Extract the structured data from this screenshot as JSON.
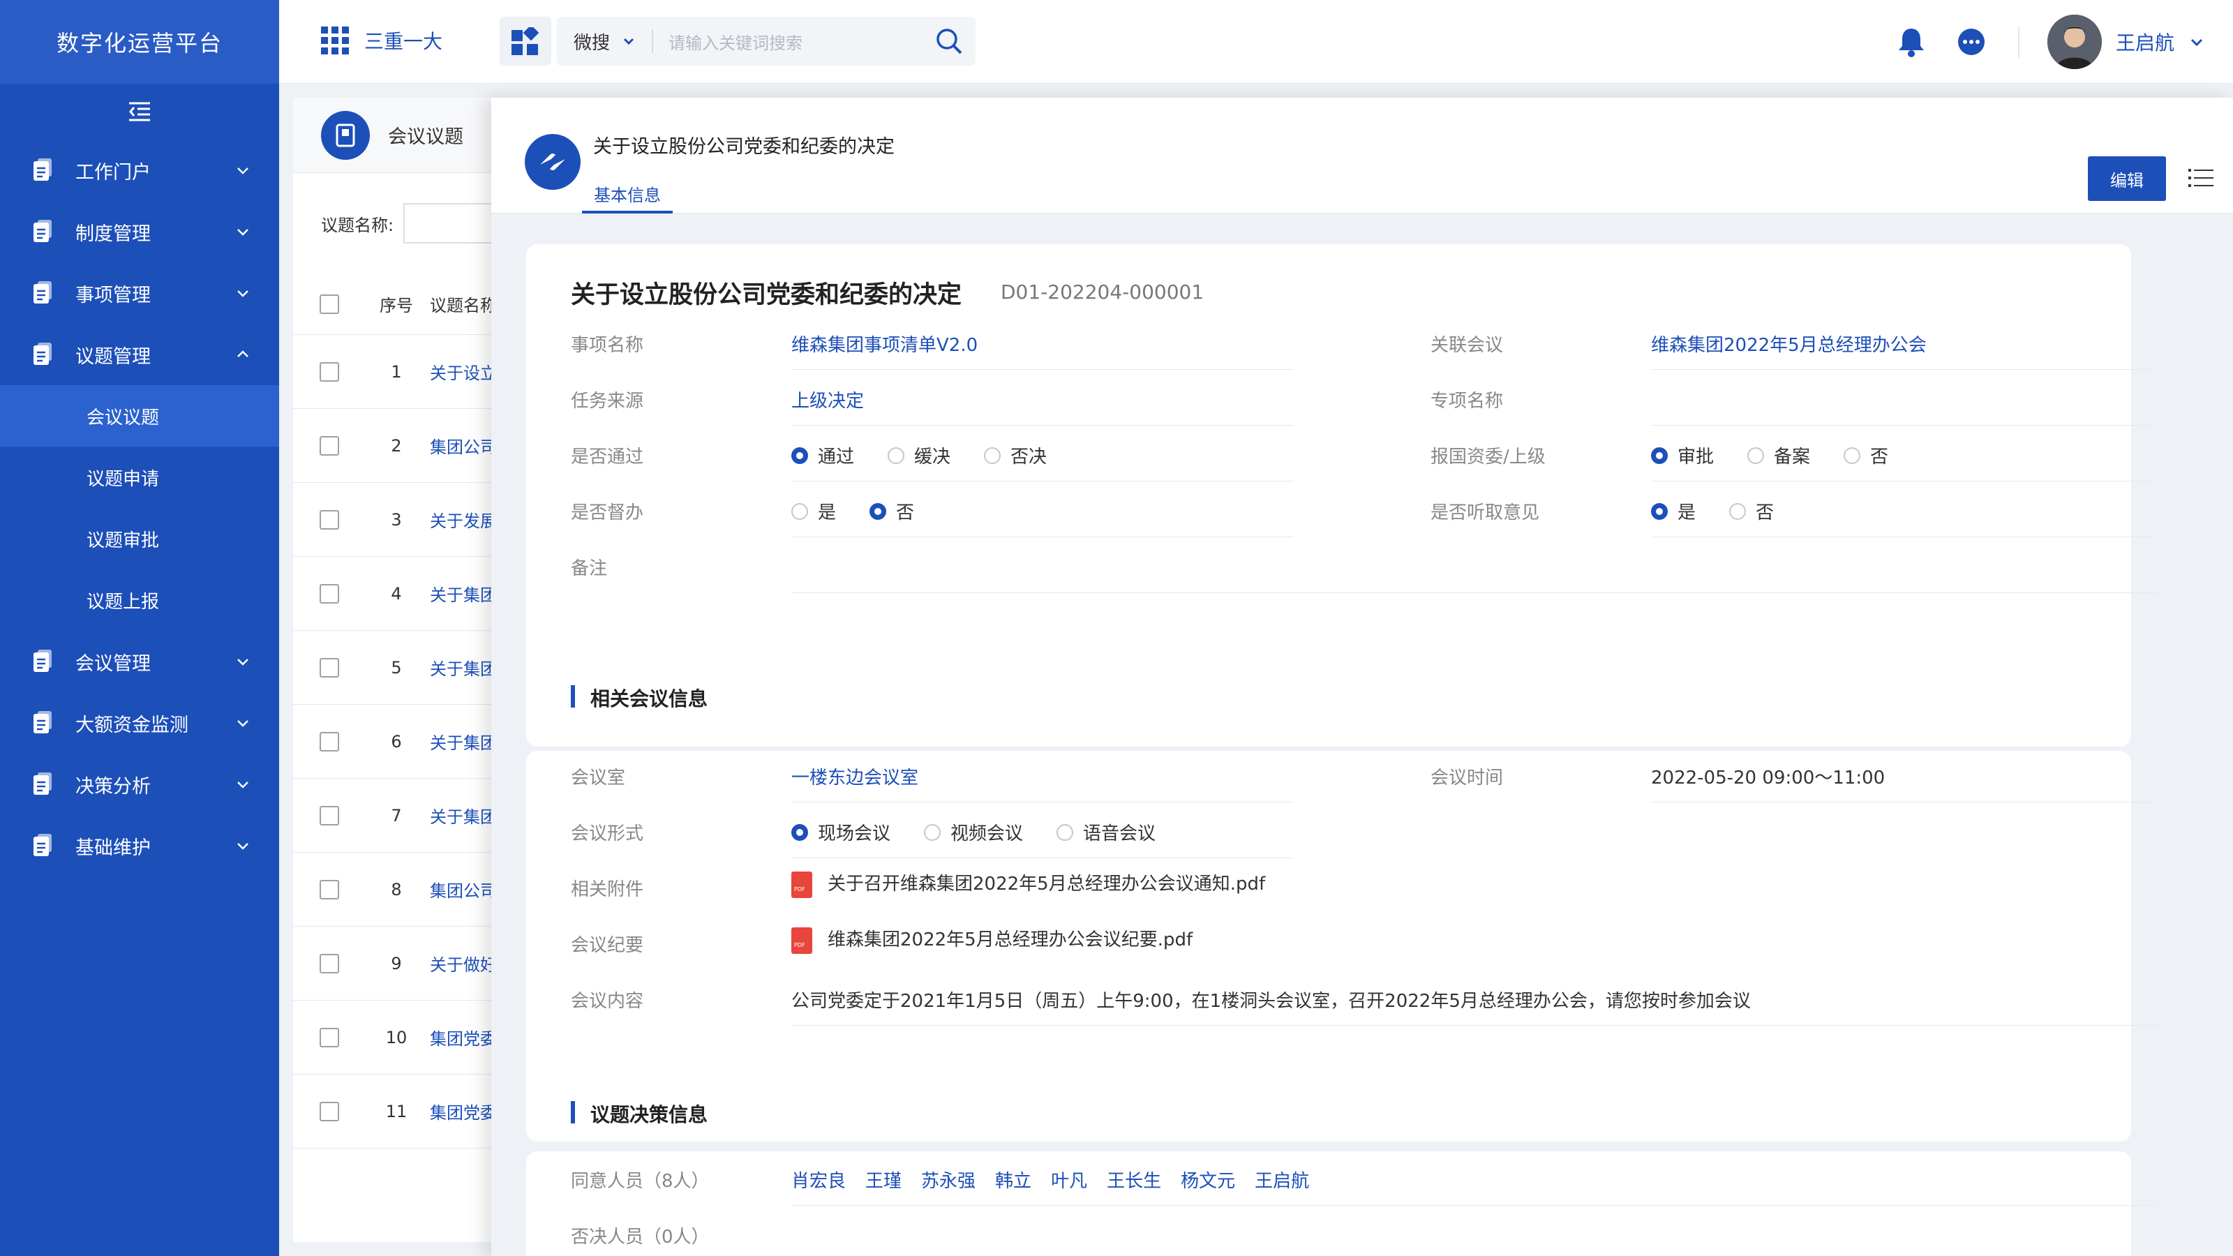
{
  "sidebar": {
    "brand": "数字化运营平台",
    "items": [
      {
        "label": "工作门户"
      },
      {
        "label": "制度管理"
      },
      {
        "label": "事项管理"
      },
      {
        "label": "议题管理"
      },
      {
        "label": "会议管理"
      },
      {
        "label": "大额资金监测"
      },
      {
        "label": "决策分析"
      },
      {
        "label": "基础维护"
      }
    ],
    "submenu": [
      {
        "label": "会议议题"
      },
      {
        "label": "议题申请"
      },
      {
        "label": "议题审批"
      },
      {
        "label": "议题上报"
      }
    ]
  },
  "topbar": {
    "app_label": "三重一大",
    "search_scope": "微搜",
    "search_placeholder": "请输入关键词搜索",
    "user_name": "王启航"
  },
  "listpage": {
    "title": "会议议题",
    "filter_label": "议题名称:",
    "col_no": "序号",
    "col_name": "议题名称",
    "rows": [
      {
        "no": "1",
        "name": "关于设立"
      },
      {
        "no": "2",
        "name": "集团公司"
      },
      {
        "no": "3",
        "name": "关于发展"
      },
      {
        "no": "4",
        "name": "关于集团"
      },
      {
        "no": "5",
        "name": "关于集团"
      },
      {
        "no": "6",
        "name": "关于集团"
      },
      {
        "no": "7",
        "name": "关于集团"
      },
      {
        "no": "8",
        "name": "集团公司"
      },
      {
        "no": "9",
        "name": "关于做好"
      },
      {
        "no": "10",
        "name": "集团党委"
      },
      {
        "no": "11",
        "name": "集团党委"
      }
    ]
  },
  "detail": {
    "header_title": "关于设立股份公司党委和纪委的决定",
    "tab": "基本信息",
    "edit_label": "编辑",
    "title": "关于设立股份公司党委和纪委的决定",
    "code": "D01-202204-000001",
    "basic": {
      "item_name_label": "事项名称",
      "item_name": "维森集团事项清单V2.0",
      "meeting_label": "关联会议",
      "meeting": "维森集团2022年5月总经理办公会",
      "source_label": "任务来源",
      "source": "上级决定",
      "special_label": "专项名称",
      "pass_label": "是否通过",
      "pass_options": [
        "通过",
        "缓决",
        "否决"
      ],
      "pass_selected": "通过",
      "report_label": "报国资委/上级",
      "report_options": [
        "审批",
        "备案",
        "否"
      ],
      "report_selected": "审批",
      "supervise_label": "是否督办",
      "supervise_options": [
        "是",
        "否"
      ],
      "supervise_selected": "否",
      "opinion_label": "是否听取意见",
      "opinion_options": [
        "是",
        "否"
      ],
      "opinion_selected": "是",
      "remark_label": "备注"
    },
    "meeting_info": {
      "section_title": "相关会议信息",
      "room_label": "会议室",
      "room": "一楼东边会议室",
      "time_label": "会议时间",
      "time": "2022-05-20  09:00～11:00",
      "form_label": "会议形式",
      "form_options": [
        "现场会议",
        "视频会议",
        "语音会议"
      ],
      "form_selected": "现场会议",
      "attach_label": "相关附件",
      "attach": "关于召开维森集团2022年5月总经理办公会议通知.pdf",
      "minutes_label": "会议纪要",
      "minutes": "维森集团2022年5月总经理办公会议纪要.pdf",
      "content_label": "会议内容",
      "content": "公司党委定于2021年1月5日（周五）上午9:00，在1楼洞头会议室，召开2022年5月总经理办公会，请您按时参加会议"
    },
    "decision": {
      "section_title": "议题决策信息",
      "agree_label": "同意人员（8人）",
      "agree": [
        "肖宏良",
        "王瑾",
        "苏永强",
        "韩立",
        "叶凡",
        "王长生",
        "杨文元",
        "王启航"
      ],
      "reject_label": "否决人员（0人）"
    }
  },
  "colors": {
    "primary": "#1d4fb9",
    "pdf": "#e8453c"
  }
}
